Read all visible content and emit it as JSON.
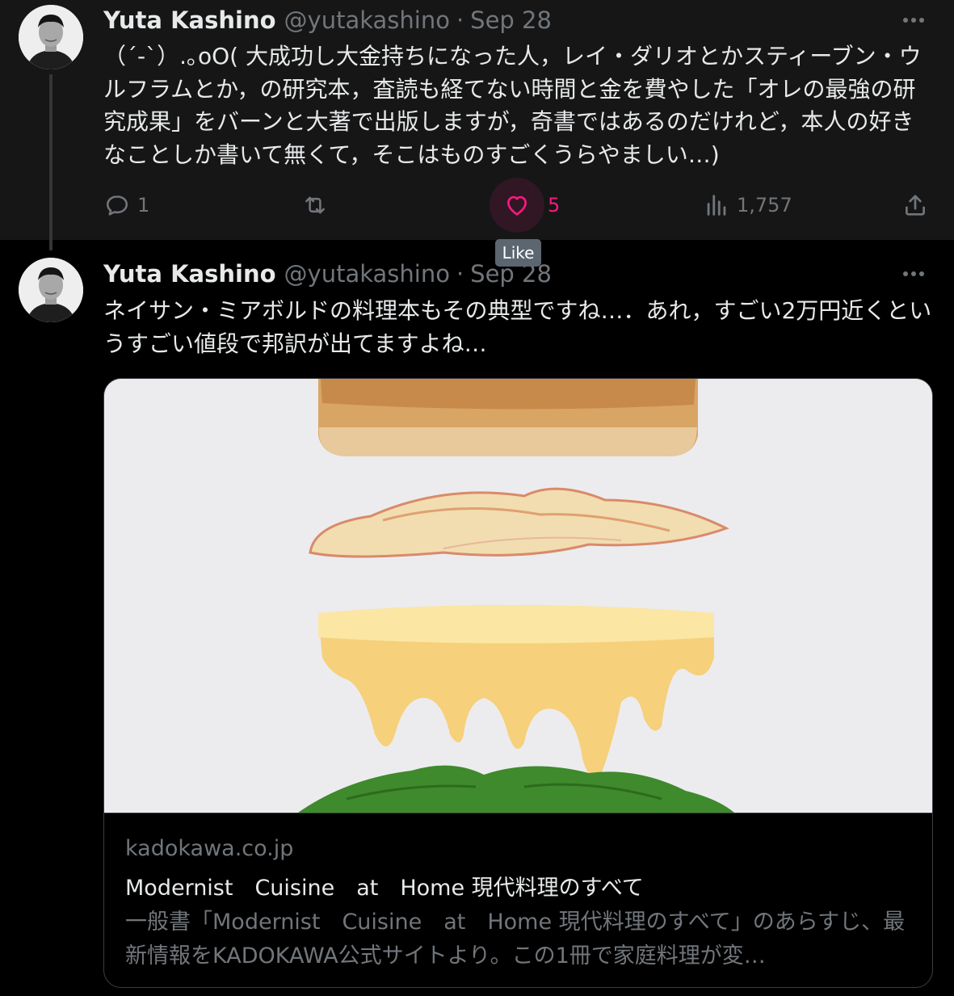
{
  "tweets": [
    {
      "author": {
        "name": "Yuta Kashino",
        "handle": "@yutakashino"
      },
      "separator": "·",
      "date": "Sep 28",
      "text": "（´-`）.｡oO( 大成功し大金持ちになった人，レイ・ダリオとかスティーブン・ウルフラムとか，の研究本，査読も経てない時間と金を費やした「オレの最強の研究成果」をバーンと大著で出版しますが，奇書ではあるのだけれど，本人の好きなことしか書いて無くて，そこはものすごくうらやましい…)",
      "actions": {
        "replies": "1",
        "retweets": "",
        "likes": "5",
        "views": "1,757"
      },
      "like_tooltip": "Like"
    },
    {
      "author": {
        "name": "Yuta Kashino",
        "handle": "@yutakashino"
      },
      "separator": "·",
      "date": "Sep 28",
      "text": "ネイサン・ミアボルドの料理本もその典型ですね…．あれ，すごい2万円近くというすごい値段で邦訳が出てますよね…",
      "card": {
        "domain": "kadokawa.co.jp",
        "title": "Modernist　Cuisine　at　Home 現代料理のすべて",
        "description": "一般書「Modernist　Cuisine　at　Home 現代料理のすべて」のあらすじ、最新情報をKADOKAWA公式サイトより。この1冊で家庭料理が変…"
      }
    }
  ],
  "colors": {
    "background": "#000000",
    "tweet_highlight_background": "#161616",
    "text_primary": "#e7e9ea",
    "text_secondary": "#71767b",
    "like_accent": "#f91880",
    "tooltip_background": "#5b6670"
  },
  "icons": [
    "more-icon",
    "reply-icon",
    "retweet-icon",
    "like-icon",
    "views-icon",
    "share-icon"
  ]
}
